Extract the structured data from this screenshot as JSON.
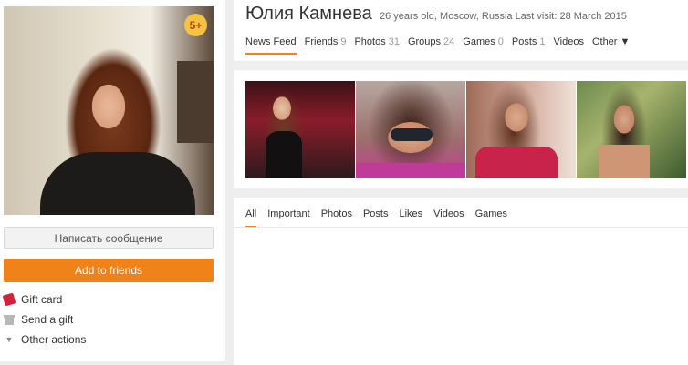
{
  "profile": {
    "name": "Юлия Камнева",
    "meta": "26 years old, Moscow, Russia  Last visit: 28 March 2015",
    "badge": "5+"
  },
  "actions": {
    "message_label": "Написать сообщение",
    "add_friends_label": "Add to friends",
    "links": [
      {
        "label": "Gift card",
        "icon": "gift-card-icon"
      },
      {
        "label": "Send a gift",
        "icon": "gift-icon"
      },
      {
        "label": "Other actions",
        "icon": "caret-down-icon"
      }
    ]
  },
  "nav": {
    "tabs": [
      {
        "label": "News Feed",
        "count": ""
      },
      {
        "label": "Friends",
        "count": "9"
      },
      {
        "label": "Photos",
        "count": "31"
      },
      {
        "label": "Groups",
        "count": "24"
      },
      {
        "label": "Games",
        "count": "0"
      },
      {
        "label": "Posts",
        "count": "1"
      },
      {
        "label": "Videos",
        "count": ""
      },
      {
        "label": "Other ▼",
        "count": ""
      }
    ]
  },
  "feed": {
    "tabs": [
      "All",
      "Important",
      "Photos",
      "Posts",
      "Likes",
      "Videos",
      "Games"
    ]
  },
  "colors": {
    "accent": "#ef8219",
    "badge": "#f5c242"
  }
}
